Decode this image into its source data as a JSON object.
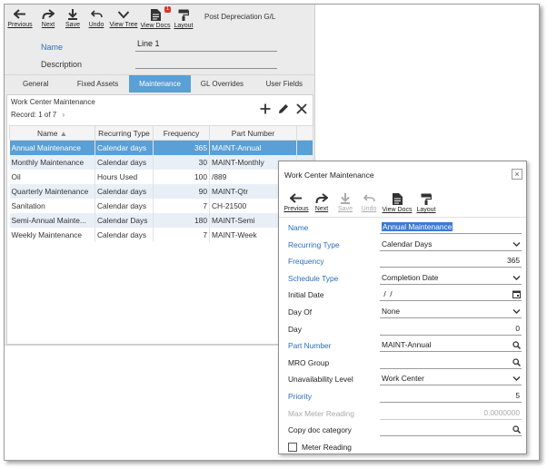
{
  "main_toolbar": {
    "previous": "Previous",
    "next": "Next",
    "save": "Save",
    "undo": "Undo",
    "view_tree": "View Tree",
    "view_docs": "View Docs",
    "view_docs_badge": "1",
    "layout": "Layout",
    "post_depreciation": "Post Depreciation G/L"
  },
  "header": {
    "name_label": "Name",
    "name_value": "Line 1",
    "description_label": "Description",
    "description_value": ""
  },
  "tabs": [
    "General",
    "Fixed Assets",
    "Maintenance",
    "GL Overrides",
    "User Fields"
  ],
  "active_tab": "Maintenance",
  "grid_panel": {
    "title": "Work Center Maintenance",
    "record": "Record: 1 of 7",
    "record_nav": "›",
    "columns": [
      "Name",
      "Recurring Type",
      "Frequency",
      "Part Number"
    ],
    "rows": [
      [
        "Annual Maintenance",
        "Calendar days",
        "365",
        "MAINT-Annual"
      ],
      [
        "Monthly Maintenance",
        "Calendar days",
        "30",
        "MAINT-Monthly"
      ],
      [
        "Oil",
        "Hours Used",
        "100",
        "/889"
      ],
      [
        "Quarterly Maintenance",
        "Calendar days",
        "90",
        "MAINT-Qtr"
      ],
      [
        "Sanitation",
        "Calendar days",
        "7",
        "CH-21500"
      ],
      [
        "Semi-Annual Mainte...",
        "Calendar Days",
        "180",
        "MAINT-Semi"
      ],
      [
        "Weekly Maintenance",
        "Calendar days",
        "7",
        "MAINT-Week"
      ]
    ]
  },
  "dialog": {
    "title": "Work Center Maintenance",
    "close": "×",
    "toolbar": {
      "previous": "Previous",
      "next": "Next",
      "save": "Save",
      "undo": "Undo",
      "view_docs": "View Docs",
      "layout": "Layout"
    },
    "fields": {
      "name_label": "Name",
      "name_value": "Annual Maintenance",
      "recurring_type_label": "Recurring Type",
      "recurring_type_value": "Calendar Days",
      "frequency_label": "Frequency",
      "frequency_value": "365",
      "schedule_type_label": "Schedule Type",
      "schedule_type_value": "Completion Date",
      "initial_date_label": "Initial Date",
      "initial_date_value": " /  /",
      "day_of_label": "Day Of",
      "day_of_value": "None",
      "day_label": "Day",
      "day_value": "0",
      "part_number_label": "Part Number",
      "part_number_value": "MAINT-Annual",
      "mro_group_label": "MRO Group",
      "mro_group_value": "",
      "unavailability_level_label": "Unavailability Level",
      "unavailability_level_value": "Work Center",
      "priority_label": "Priority",
      "priority_value": "5",
      "max_meter_reading_label": "Max Meter Reading",
      "max_meter_reading_value": "0.0000000",
      "copy_doc_category_label": "Copy doc category",
      "copy_doc_category_value": "",
      "meter_reading_label": "Meter Reading"
    }
  },
  "colors": {
    "accent": "#5a9fd6",
    "link_label": "#2a6ebb",
    "badge": "#d9342b",
    "highlight": "#3a7bd5"
  }
}
